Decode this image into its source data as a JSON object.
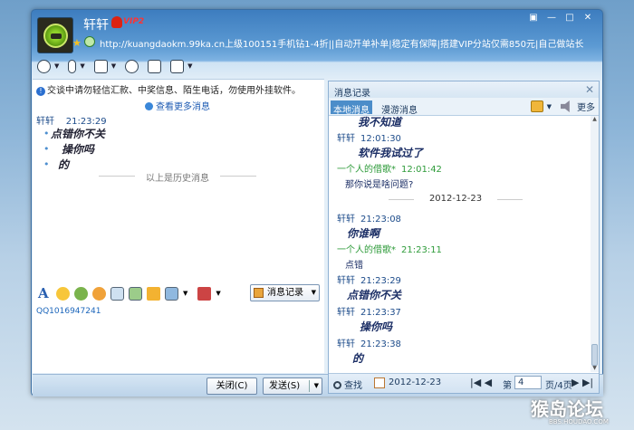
{
  "window": {
    "contact_name": "轩轩",
    "vip_label": "VIP2",
    "signature": "http://kuangdaokm.99ka.cn上级100151手机钻1-4折||自动开单补单|稳定有保障|搭建VIP分站仅需850元|自己做站长",
    "controls": [
      "▣",
      "—",
      "□",
      "✕"
    ]
  },
  "left": {
    "notice": "交谈中请勿轻信汇款、中奖信息、陌生电话，勿使用外挂软件。",
    "more_messages": "查看更多消息",
    "history_sender": "轩轩",
    "history_time": "21:23:29",
    "history_lines": [
      "点错你不关",
      "操你吗",
      "的"
    ],
    "history_divider": "以上是历史消息",
    "message_record_button": "消息记录",
    "qq_text": "QQ1016947241"
  },
  "bottom": {
    "close_label": "关闭(C)",
    "send_label": "发送(S)"
  },
  "record": {
    "title": "消息记录",
    "tab_local": "本地消息",
    "tab_roam": "漫游消息",
    "more": "更多",
    "messages": [
      {
        "text": "我不知道"
      },
      {
        "sender": "轩轩",
        "time": "12:01:30"
      },
      {
        "text": "软件我试过了"
      },
      {
        "sender": "一个人的借歌*",
        "time": "12:01:42"
      },
      {
        "text_plain": "那你说是啥问题?"
      },
      {
        "date": "2012-12-23"
      },
      {
        "sender": "轩轩",
        "time": "21:23:08"
      },
      {
        "text": "你谁啊"
      },
      {
        "sender": "一个人的借歌*",
        "time": "21:23:11"
      },
      {
        "text_plain": "点错"
      },
      {
        "sender": "轩轩",
        "time": "21:23:29"
      },
      {
        "text": "点错你不关"
      },
      {
        "sender": "轩轩",
        "time": "21:23:37"
      },
      {
        "text": "操你吗"
      },
      {
        "sender": "轩轩",
        "time": "21:23:38"
      },
      {
        "text": "的"
      }
    ],
    "footer": {
      "find": "查找",
      "date": "2012-12-23",
      "page_label": "第",
      "page": "4",
      "total": "页/4页"
    }
  },
  "watermark": {
    "title": "猴岛论坛",
    "url": "BBS.HOUDAO.COM"
  }
}
